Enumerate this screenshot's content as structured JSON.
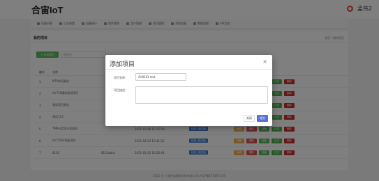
{
  "app": {
    "brand": "合宙IoT",
    "user_name": "孟伟2",
    "user_icon": "user-icon"
  },
  "nav": {
    "items": [
      {
        "label": "设备列表",
        "icon": "list-icon"
      },
      {
        "label": "日志查看",
        "icon": "log-icon"
      },
      {
        "label": "设备统计",
        "icon": "stats-icon"
      },
      {
        "label": "固件管理",
        "icon": "firmware-icon"
      },
      {
        "label": "用户管理",
        "icon": "user-icon"
      },
      {
        "label": "项目管理",
        "icon": "project-icon"
      },
      {
        "label": "添加设备",
        "icon": "add-icon"
      },
      {
        "label": "数据管理",
        "icon": "data-icon"
      },
      {
        "label": "API文档",
        "icon": "doc-icon"
      }
    ]
  },
  "content": {
    "title": "我的项目",
    "breadcrumb": "首页 / 我的项目",
    "add_button": "+ 添加项目",
    "search_placeholder": "项目名"
  },
  "table": {
    "headers": [
      "编号",
      "名称",
      "",
      "",
      "",
      ""
    ],
    "rows": [
      {
        "id": "1",
        "name": "NTP时间测试",
        "code": "",
        "time": "",
        "status": ""
      },
      {
        "id": "2",
        "name": "Air720模块测试项目",
        "code": "",
        "time": "",
        "status": ""
      },
      {
        "id": "3",
        "name": "测试项目测试",
        "code": "",
        "time": "",
        "status": ""
      },
      {
        "id": "4",
        "name": "测试123",
        "code": "",
        "time": "",
        "status": ""
      },
      {
        "id": "5",
        "name": "TMPro定位开发测试",
        "code": "",
        "time": "2021-03-08 15:25:00",
        "status": "标准 (测试版)"
      },
      {
        "id": "6",
        "name": "Air720开发板测试",
        "code": "",
        "time": "2021-03-22 10:41:25",
        "status": "标准 (测试版)"
      },
      {
        "id": "7",
        "name": "8101",
        "code": "8101abcd",
        "time": "2021-03-22 16:26:44",
        "status": "标准 (测试版)"
      }
    ],
    "ops": [
      "编辑",
      "删除",
      "设备",
      "日志",
      "删除"
    ]
  },
  "footer": "2021 © 上海合宙通信科技有限公司 沪ICP备17046715号",
  "modal": {
    "title": "添加项目",
    "close_glyph": "×",
    "name_label": "项目名称:",
    "name_value": "Air8101 test",
    "desc_label": "项目描述:",
    "cancel_label": "关闭",
    "confirm_label": "提交"
  },
  "colors": {
    "primary": "#5b6fd6",
    "success": "#5cb85c",
    "warning": "#f0ad4e",
    "danger": "#d9534f",
    "info": "#3f7ed6"
  }
}
